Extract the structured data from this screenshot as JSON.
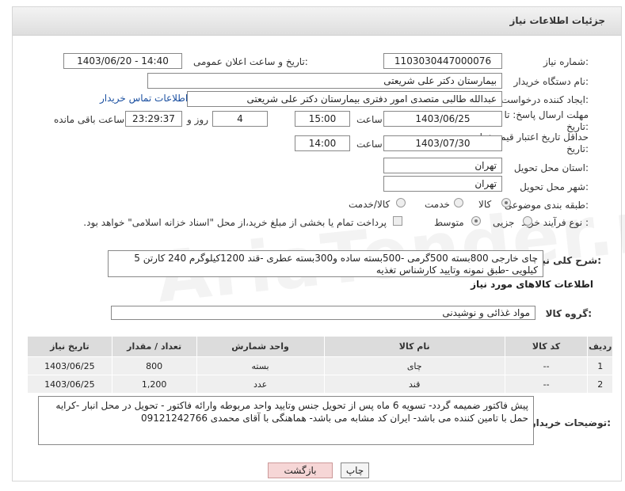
{
  "header": {
    "title": "جزئیات اطلاعات نیاز"
  },
  "form": {
    "need_number_label": "شماره نیاز:",
    "need_number": "1103030447000076",
    "announce_label": "تاریخ و ساعت اعلان عمومی:",
    "announce_value": "1403/06/20 - 14:40",
    "buyer_label": "نام دستگاه خریدار:",
    "buyer_value": "بیمارستان دکتر علی شریعتی",
    "creator_label": "ایجاد کننده درخواست:",
    "creator_value": "عبدالله طالبی متصدی امور دفتری بیمارستان دکتر علی شریعتی",
    "contact_link": "اطلاعات تماس خریدار",
    "deadline_label": "مهلت ارسال پاسخ: تا",
    "deadline_label2": "تاریخ:",
    "deadline_date": "1403/06/25",
    "time_label": "ساعت",
    "deadline_time": "15:00",
    "days": "4",
    "days_label": "روز و",
    "remaining": "23:29:37",
    "remaining_label": "ساعت باقی مانده",
    "validity_label": "حداقل تاریخ اعتبار قیمت: تا",
    "validity_label2": "تاریخ:",
    "validity_date": "1403/07/30",
    "validity_time": "14:00",
    "province_label": "استان محل تحویل:",
    "province_value": "تهران",
    "city_label": "شهر محل تحویل:",
    "city_value": "تهران",
    "category_label": "طبقه بندی موضوعی:",
    "cat_goods": "کالا",
    "cat_service": "خدمت",
    "cat_both": "کالا/خدمت",
    "process_label": "نوع فرآیند خرید :",
    "proc_minor": "جزیی",
    "proc_medium": "متوسط",
    "payment_note": "پرداخت تمام یا بخشی از مبلغ خرید،از محل \"اسناد خزانه اسلامی\" خواهد بود."
  },
  "description": {
    "label": "شرح کلی نیاز:",
    "text": "چای خارجی  800بسته 500گرمی  -500بسته ساده و300بسته عطری -قند 1200کیلوگرم 240 کارتن 5 کیلویی -طبق نمونه وتایید کارشناس تغذیه"
  },
  "goods_section": {
    "title": "اطلاعات کالاهای مورد نیاز",
    "group_label": "گروه کالا:",
    "group_value": "مواد غذائی و نوشیدنی"
  },
  "table": {
    "headers": [
      "ردیف",
      "کد کالا",
      "نام کالا",
      "واحد شمارش",
      "تعداد / مقدار",
      "تاریخ نیاز"
    ],
    "rows": [
      [
        "1",
        "--",
        "چای",
        "بسته",
        "800",
        "1403/06/25"
      ],
      [
        "2",
        "--",
        "قند",
        "عدد",
        "1,200",
        "1403/06/25"
      ]
    ]
  },
  "buyer_notes": {
    "label": "توضیحات خریدار:",
    "text": "پیش فاکتور ضمیمه گردد- تسویه 6 ماه پس از تحویل جنس وتایید واحد مربوطه وارائه فاکتور - تحویل در محل انبار -کرایه حمل با تامین کننده می باشد- ایران کد مشابه می باشد- هماهنگی با آقای محمدی 09121242766"
  },
  "buttons": {
    "print": "چاپ",
    "back": "بازگشت"
  },
  "watermark": "AriaTender.neT"
}
